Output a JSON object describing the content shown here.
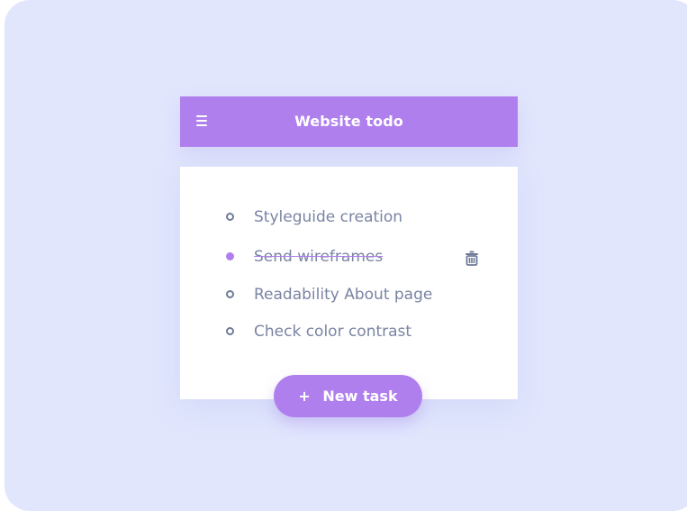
{
  "header": {
    "title": "Website todo",
    "menu_icon": "hamburger-menu-icon"
  },
  "todos": [
    {
      "label": "Styleguide creation",
      "done": false
    },
    {
      "label": "Send wireframes",
      "done": true
    },
    {
      "label": "Readability About page",
      "done": false
    },
    {
      "label": "Check color contrast",
      "done": false
    }
  ],
  "actions": {
    "delete_icon": "trash-icon",
    "new_task_plus": "+",
    "new_task_label": "New task"
  },
  "colors": {
    "background": "#e1e6fd",
    "accent": "#b07fee",
    "text": "#7a84a3",
    "card": "#ffffff"
  }
}
